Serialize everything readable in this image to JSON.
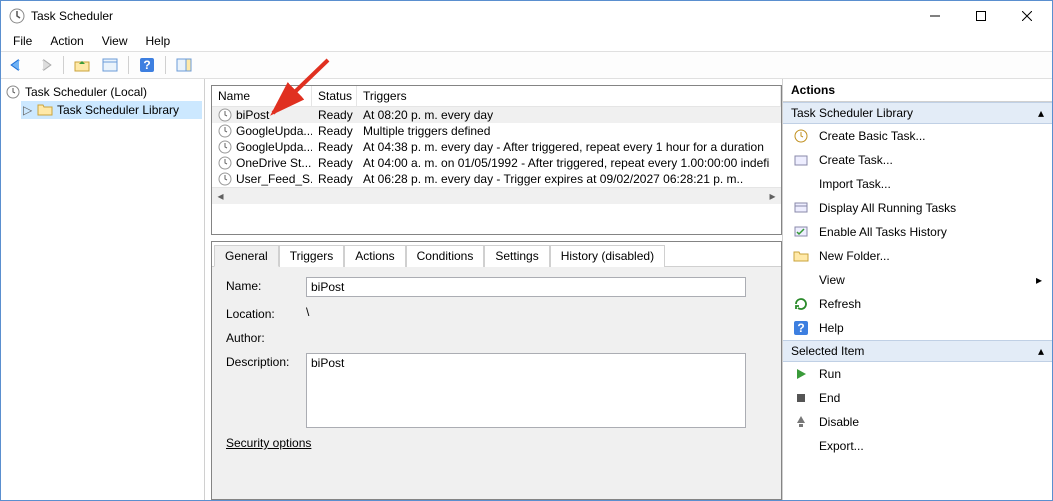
{
  "window": {
    "title": "Task Scheduler"
  },
  "menu": {
    "file": "File",
    "action": "Action",
    "view": "View",
    "help": "Help"
  },
  "nav": {
    "root": "Task Scheduler (Local)",
    "library": "Task Scheduler Library"
  },
  "list": {
    "headers": {
      "name": "Name",
      "status": "Status",
      "triggers": "Triggers"
    },
    "rows": [
      {
        "name": "biPost",
        "status": "Ready",
        "triggers": "At 08:20 p. m. every day"
      },
      {
        "name": "GoogleUpda...",
        "status": "Ready",
        "triggers": "Multiple triggers defined"
      },
      {
        "name": "GoogleUpda...",
        "status": "Ready",
        "triggers": "At 04:38 p. m. every day - After triggered, repeat every 1 hour for a duration"
      },
      {
        "name": "OneDrive St...",
        "status": "Ready",
        "triggers": "At 04:00 a. m. on 01/05/1992 - After triggered, repeat every 1.00:00:00 indefi"
      },
      {
        "name": "User_Feed_S...",
        "status": "Ready",
        "triggers": "At 06:28 p. m. every day - Trigger expires at 09/02/2027 06:28:21 p. m.."
      }
    ]
  },
  "tabs": {
    "general": "General",
    "triggers": "Triggers",
    "actions": "Actions",
    "conditions": "Conditions",
    "settings": "Settings",
    "history": "History (disabled)"
  },
  "details": {
    "name_lbl": "Name:",
    "name_val": "biPost",
    "location_lbl": "Location:",
    "location_val": "\\",
    "author_lbl": "Author:",
    "author_val": "",
    "desc_lbl": "Description:",
    "desc_val": "biPost",
    "secopts": "Security options"
  },
  "actions": {
    "title": "Actions",
    "group1": "Task Scheduler Library",
    "items1": [
      "Create Basic Task...",
      "Create Task...",
      "Import Task...",
      "Display All Running Tasks",
      "Enable All Tasks History",
      "New Folder...",
      "View",
      "Refresh",
      "Help"
    ],
    "group2": "Selected Item",
    "items2": [
      "Run",
      "End",
      "Disable",
      "Export..."
    ]
  }
}
